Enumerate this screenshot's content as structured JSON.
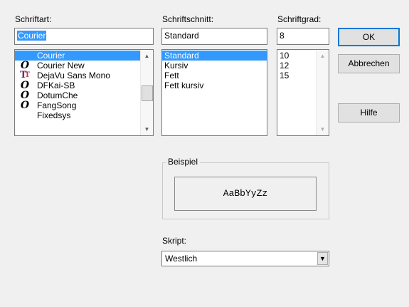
{
  "labels": {
    "font": "Schriftart:",
    "style": "Schriftschnitt:",
    "size": "Schriftgrad:",
    "sample": "Beispiel",
    "script": "Skript:"
  },
  "font": {
    "value": "Courier",
    "items": [
      {
        "label": "Courier",
        "icon": "none",
        "selected": true
      },
      {
        "label": "Courier New",
        "icon": "opentype-icon"
      },
      {
        "label": "DejaVu Sans Mono",
        "icon": "truetype-icon"
      },
      {
        "label": "DFKai-SB",
        "icon": "opentype-icon"
      },
      {
        "label": "DotumChe",
        "icon": "opentype-icon"
      },
      {
        "label": "FangSong",
        "icon": "opentype-icon"
      },
      {
        "label": "Fixedsys",
        "icon": "none"
      }
    ]
  },
  "style": {
    "value": "Standard",
    "items": [
      "Standard",
      "Kursiv",
      "Fett",
      "Fett kursiv"
    ]
  },
  "size": {
    "value": "8",
    "items": [
      "10",
      "12",
      "15"
    ]
  },
  "buttons": {
    "ok": "OK",
    "cancel": "Abbrechen",
    "help": "Hilfe"
  },
  "sample_text": "AaBbYyZz",
  "script": {
    "value": "Westlich"
  },
  "colors": {
    "selection": "#3399ff",
    "default_button_border": "#0078d7"
  }
}
